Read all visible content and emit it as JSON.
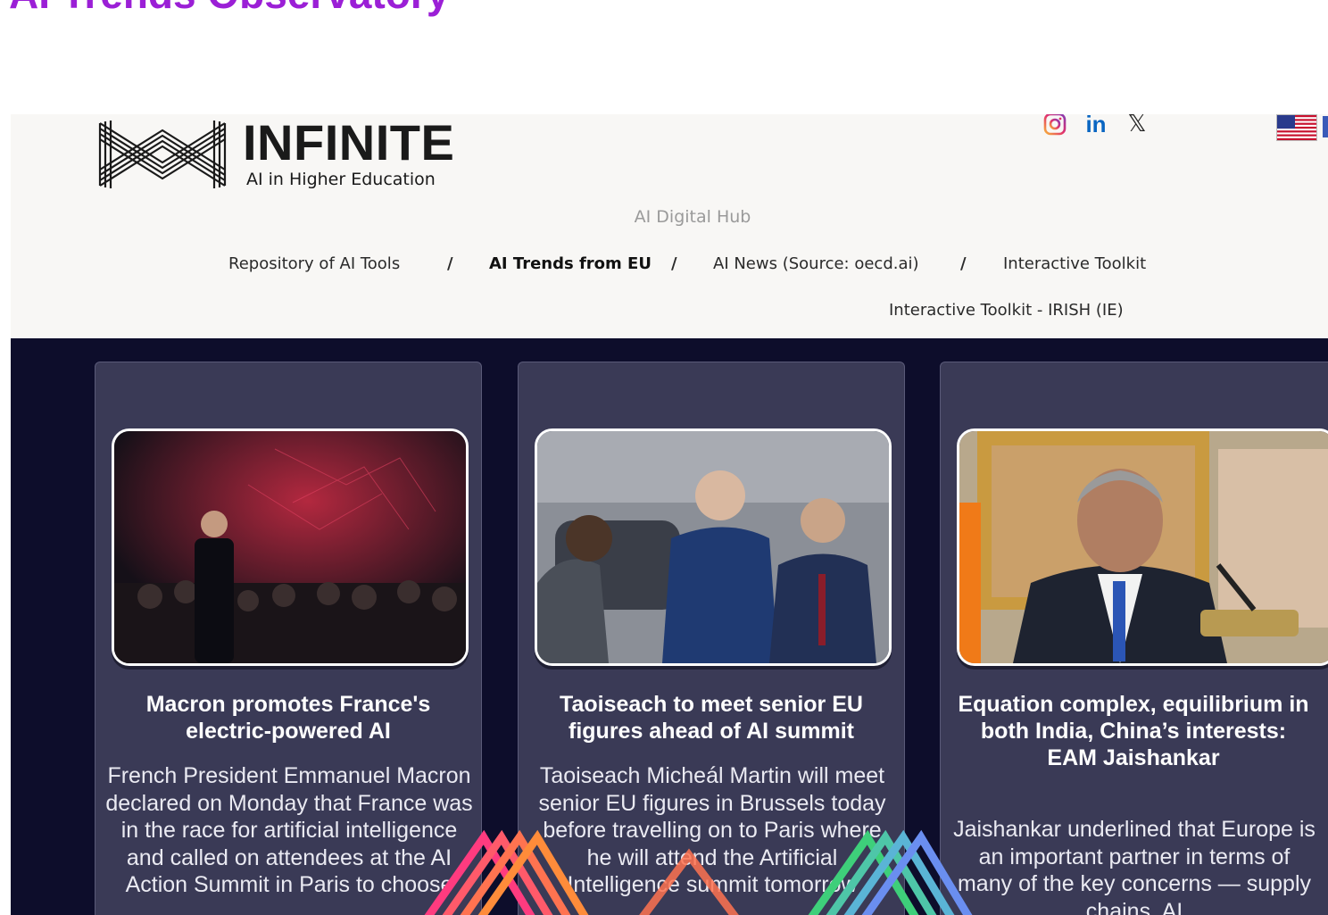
{
  "page": {
    "title": "AI Trends Observatory"
  },
  "header": {
    "logo_word": "INFINITE",
    "logo_tagline": "AI in Higher Education",
    "hub_label": "AI Digital Hub",
    "socials": [
      {
        "icon": "instagram-icon"
      },
      {
        "icon": "linkedin-icon",
        "glyph": "in"
      },
      {
        "icon": "x-icon",
        "glyph": "𝕏"
      }
    ],
    "flag_icon": "us-flag-icon"
  },
  "nav": {
    "items": [
      "Repository of AI Tools",
      "AI Trends from EU",
      "AI News (Source: oecd.ai)",
      "Interactive Toolkit",
      "Interactive Toolkit - IRISH (IE)"
    ],
    "separator": "/",
    "active_index": 1
  },
  "cards": [
    {
      "title": "Macron promotes France's electric-powered AI",
      "body": "French President Emmanuel Macron declared on Monday that France was in the race for artificial intelligence and called on attendees at the AI Action Summit in Paris to choose"
    },
    {
      "title": "Taoiseach to meet senior EU figures ahead of AI summit",
      "body": "Taoiseach Micheál Martin will meet senior EU figures in Brussels today before travelling on to Paris where he will attend the Artificial Intelligence summit tomorrow"
    },
    {
      "title": "Equation complex, equilibrium in both India, China’s interests: EAM Jaishankar",
      "body": "Jaishankar underlined that Europe is an important partner in terms of many of the key concerns — supply chains, AI"
    }
  ],
  "colors": {
    "title": "#9b1fd6",
    "banner": "#0d0d2b",
    "card": "#3a3a56"
  }
}
